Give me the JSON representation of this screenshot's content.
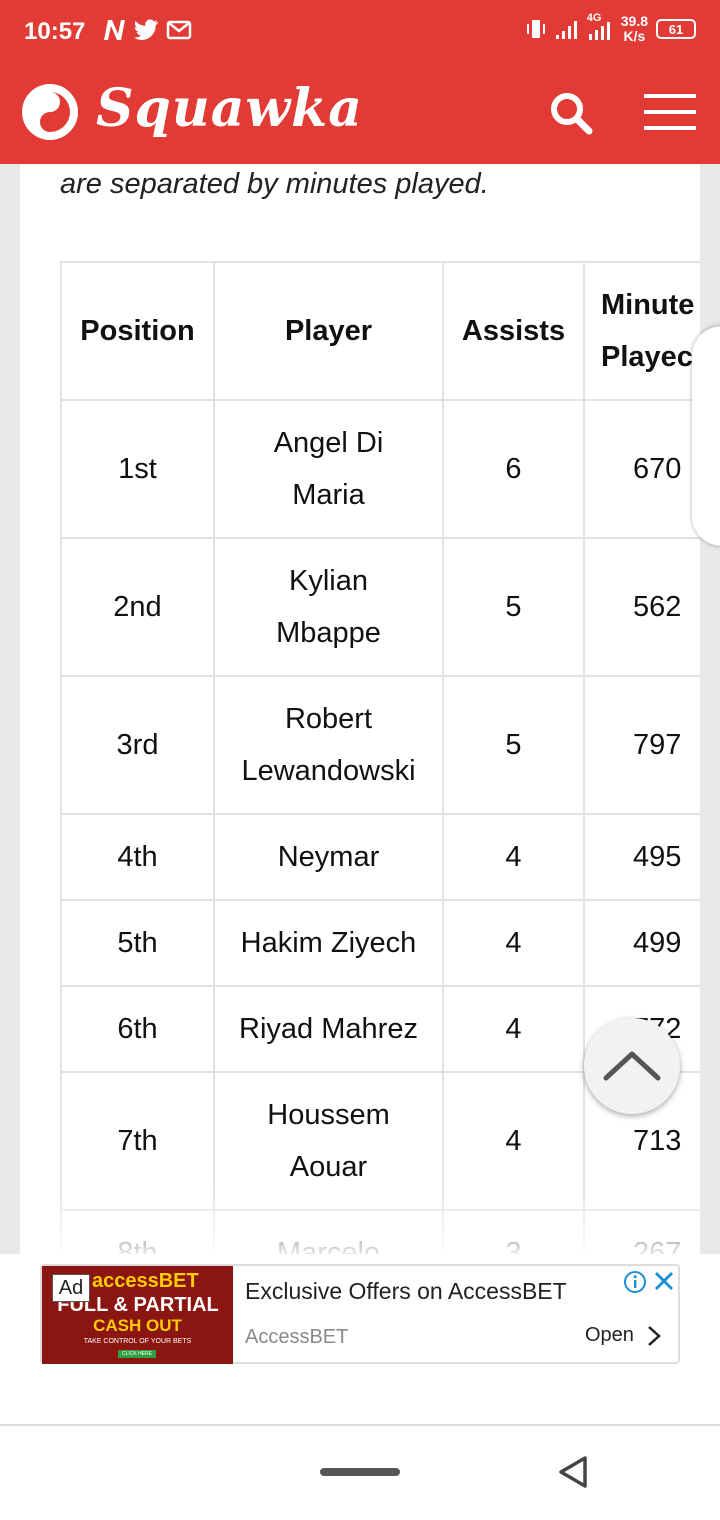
{
  "status_bar": {
    "time": "10:57",
    "network_speed_value": "39.8",
    "network_speed_unit": "K/s",
    "network_type": "4G",
    "battery": "61",
    "icons": [
      "n-app-icon",
      "twitter-icon",
      "gmail-icon",
      "vibrate-icon",
      "signal-icon",
      "signal-4g-icon",
      "battery-icon"
    ]
  },
  "header": {
    "brand": "Squawka",
    "logo_icon": "squawka-logo-icon",
    "search_icon": "search-icon",
    "menu_icon": "hamburger-menu-icon",
    "color": "#e23b35"
  },
  "article": {
    "intro_text": "are separated by minutes played.",
    "table": {
      "headers": {
        "position": "Position",
        "player": "Player",
        "assists": "Assists",
        "minutes_line1": "Minute",
        "minutes_line2": "Playec"
      },
      "rows": [
        {
          "position": "1st",
          "player_line1": "Angel Di",
          "player_line2": "Maria",
          "assists": "6",
          "minutes": "670"
        },
        {
          "position": "2nd",
          "player_line1": "Kylian",
          "player_line2": "Mbappe",
          "assists": "5",
          "minutes": "562"
        },
        {
          "position": "3rd",
          "player_line1": "Robert",
          "player_line2": "Lewandowski",
          "assists": "5",
          "minutes": "797"
        },
        {
          "position": "4th",
          "player": "Neymar",
          "assists": "4",
          "minutes": "495"
        },
        {
          "position": "5th",
          "player": "Hakim Ziyech",
          "assists": "4",
          "minutes": "499"
        },
        {
          "position": "6th",
          "player": "Riyad Mahrez",
          "assists": "4",
          "minutes": "772"
        },
        {
          "position": "7th",
          "player_line1": "Houssem",
          "player_line2": "Aouar",
          "assists": "4",
          "minutes": "713"
        },
        {
          "position": "8th",
          "player": "Marcelo",
          "assists": "3",
          "minutes": "267"
        }
      ]
    }
  },
  "scroll_top_icon": "chevron-up-icon",
  "ad": {
    "badge": "Ad",
    "image_brand": "accessBET",
    "image_line1": "FULL & PARTIAL",
    "image_line2": "CASH OUT",
    "image_line3": "TAKE CONTROL OF YOUR BETS",
    "image_cta": "CLICK HERE",
    "title": "Exclusive Offers on AccessBET",
    "advertiser": "AccessBET",
    "open_label": "Open",
    "info_icon": "info-icon",
    "close_icon": "close-icon"
  },
  "nav_bar": {
    "home_icon": "home-pill",
    "back_icon": "back-triangle-icon"
  }
}
